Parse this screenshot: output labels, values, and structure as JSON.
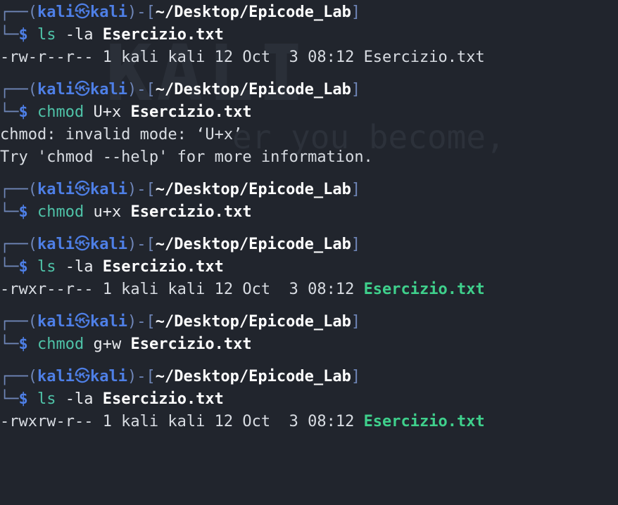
{
  "watermark": {
    "big": "KALI",
    "sub": "er you become,"
  },
  "prompt": {
    "open_lead": "┌──(",
    "user": "kali",
    "at_symbol": "㉿",
    "host": "kali",
    "mid": ")-[",
    "path": "~/Desktop/Epicode_Lab",
    "close": "]",
    "second_lead": "└─",
    "dollar": "$"
  },
  "blocks": [
    {
      "cmd": "ls",
      "args": " -la ",
      "file": "Esercizio.txt",
      "output": [
        {
          "text": "-rw-r--r-- 1 kali kali 12 Oct  3 08:12 ",
          "file": "Esercizio.txt",
          "exec": false
        }
      ]
    },
    {
      "cmd": "chmod",
      "args": " U+x ",
      "file": "Esercizio.txt",
      "output": [
        {
          "text": "chmod: invalid mode: ‘U+x’",
          "file": "",
          "exec": false
        },
        {
          "text": "Try 'chmod --help' for more information.",
          "file": "",
          "exec": false
        }
      ]
    },
    {
      "cmd": "chmod",
      "args": " u+x ",
      "file": "Esercizio.txt",
      "output": []
    },
    {
      "cmd": "ls",
      "args": " -la ",
      "file": "Esercizio.txt",
      "output": [
        {
          "text": "-rwxr--r-- 1 kali kali 12 Oct  3 08:12 ",
          "file": "Esercizio.txt",
          "exec": true
        }
      ]
    },
    {
      "cmd": "chmod",
      "args": " g+w ",
      "file": "Esercizio.txt",
      "output": []
    },
    {
      "cmd": "ls",
      "args": " -la ",
      "file": "Esercizio.txt",
      "output": [
        {
          "text": "-rwxrw-r-- 1 kali kali 12 Oct  3 08:12 ",
          "file": "Esercizio.txt",
          "exec": true
        }
      ]
    }
  ]
}
